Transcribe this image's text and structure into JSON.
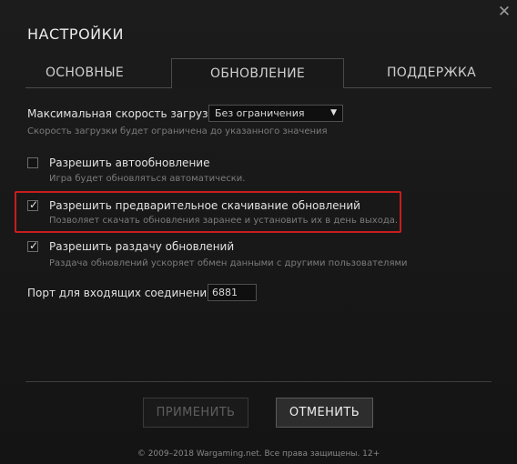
{
  "window": {
    "title": "НАСТРОЙКИ",
    "close_glyph": "✕"
  },
  "tabs": [
    {
      "label": "ОСНОВНЫЕ",
      "active": false
    },
    {
      "label": "ОБНОВЛЕНИЕ",
      "active": true
    },
    {
      "label": "ПОДДЕРЖКА",
      "active": false
    }
  ],
  "download_speed": {
    "label": "Максимальная скорость загрузки:",
    "value": "Без ограничения",
    "hint": "Скорость загрузки будет ограничена до указанного значения"
  },
  "options": [
    {
      "label": "Разрешить автообновление",
      "hint": "Игра будет обновляться автоматически.",
      "checked": false
    },
    {
      "label": "Разрешить предварительное скачивание обновлений",
      "hint": "Позволяет скачать обновления заранее и установить их в день выхода.",
      "checked": true,
      "highlighted": true
    },
    {
      "label": "Разрешить раздачу обновлений",
      "hint": "Раздача обновлений ускоряет обмен данными с другими пользователями",
      "checked": true
    }
  ],
  "port": {
    "label": "Порт для входящих соединений:",
    "value": "6881"
  },
  "buttons": {
    "apply": "ПРИМЕНИТЬ",
    "cancel": "ОТМЕНИТЬ"
  },
  "footer": "© 2009–2018 Wargaming.net. Все права защищены. 12+",
  "colors": {
    "background": "#161616",
    "highlight_border": "#c81d1d",
    "disabled_text": "#5e5e5e"
  },
  "icons": {
    "close": "close-icon",
    "dropdown": "chevron-down-icon",
    "check": "checkmark-icon"
  }
}
